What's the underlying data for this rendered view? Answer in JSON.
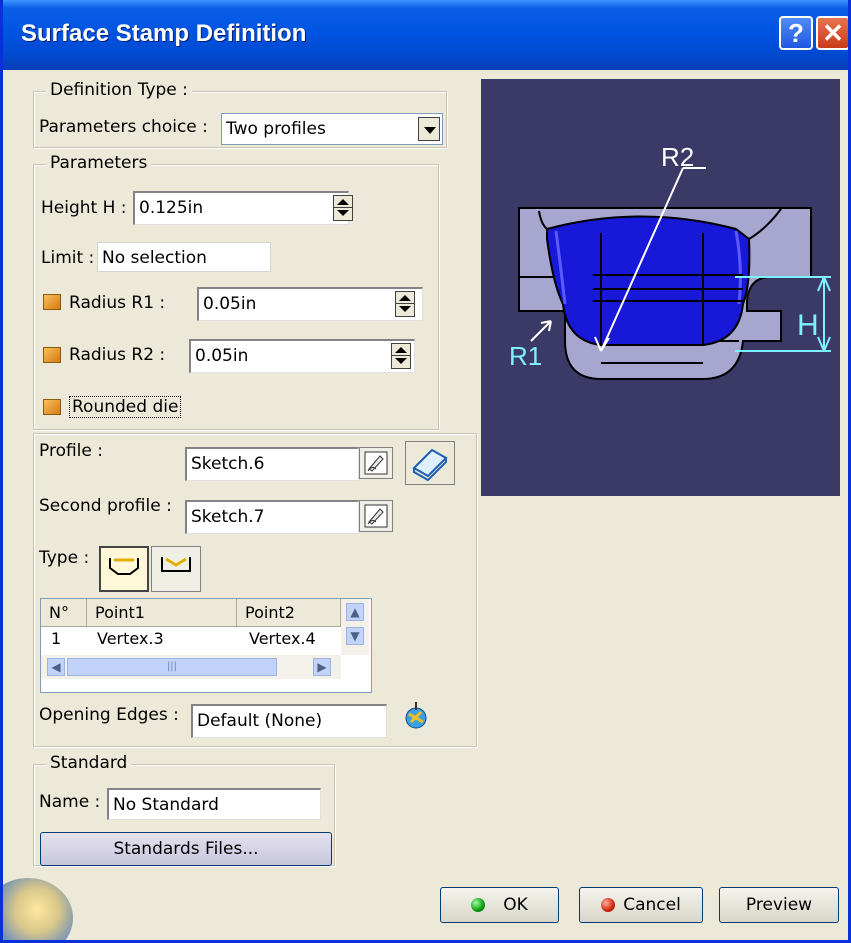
{
  "window": {
    "title": "Surface Stamp Definition",
    "help_label": "?",
    "close_label": "✕"
  },
  "definition_type": {
    "legend": "Definition Type :",
    "choice_label": "Parameters choice :",
    "choice_value": "Two profiles"
  },
  "parameters": {
    "legend": "Parameters",
    "height_label": "Height H :",
    "height_value": "0.125in",
    "limit_label": "Limit :",
    "limit_value": "No selection",
    "radius_r1_label": "Radius R1 :",
    "radius_r1_value": "0.05in",
    "radius_r2_label": "Radius R2 :",
    "radius_r2_value": "0.05in",
    "rounded_die_label": "Rounded die"
  },
  "profiles": {
    "profile_label": "Profile :",
    "profile_value": "Sketch.6",
    "second_profile_label": "Second profile :",
    "second_profile_value": "Sketch.7",
    "type_label": "Type :",
    "table": {
      "columns": [
        "N°",
        "Point1",
        "Point2"
      ],
      "rows": [
        {
          "n": "1",
          "point1": "Vertex.3",
          "point2": "Vertex.4"
        }
      ]
    },
    "opening_edges_label": "Opening Edges :",
    "opening_edges_value": "Default (None)"
  },
  "standard": {
    "legend": "Standard",
    "name_label": "Name :",
    "name_value": "No Standard",
    "files_button": "Standards Files..."
  },
  "preview_labels": {
    "r1": "R1",
    "r2": "R2",
    "h": "H"
  },
  "buttons": {
    "ok": "OK",
    "cancel": "Cancel",
    "preview": "Preview"
  },
  "colors": {
    "title_bar": "#0054e3",
    "preview_bg": "#3b3a67",
    "part_blue": "#1010d0",
    "annotation": "#7ff0ff"
  }
}
